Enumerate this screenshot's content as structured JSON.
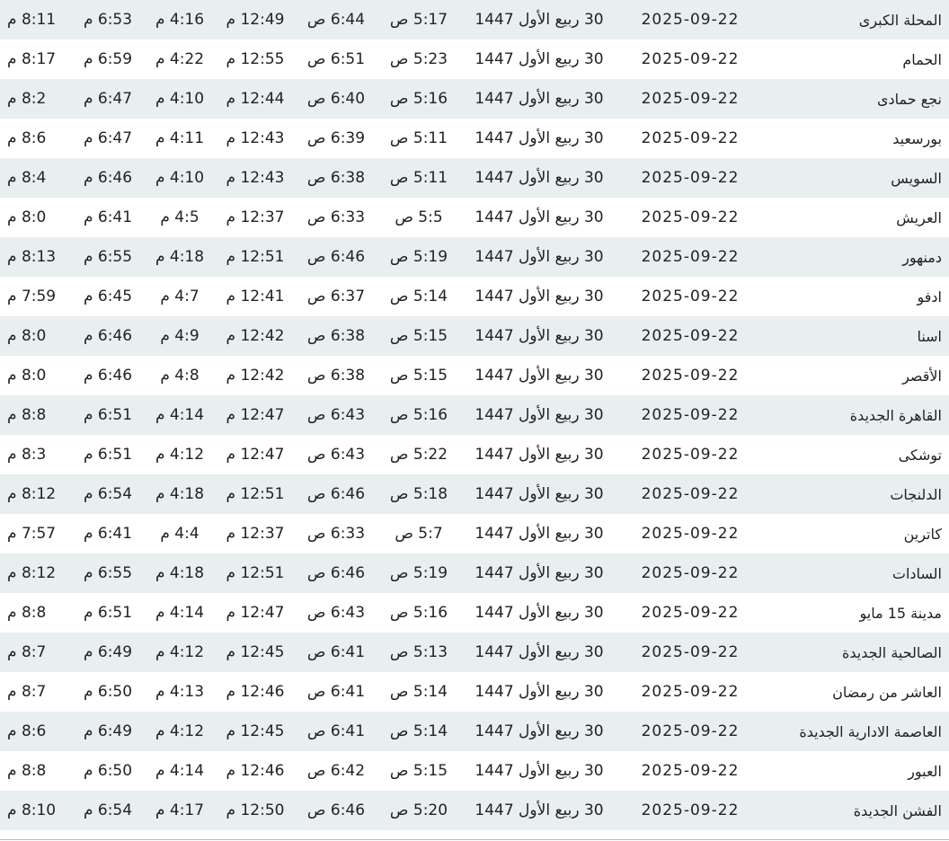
{
  "table": {
    "rows": [
      {
        "city": "المحلة الكبرى",
        "date": "2025-09-22",
        "hijri": "30 ربيع الأول 1447",
        "fajr": "5:17 ص",
        "sunrise": "6:44 ص",
        "dhuhr": "12:49 م",
        "asr": "4:16 م",
        "maghrib": "6:53 م",
        "isha": "8:11 م"
      },
      {
        "city": "الحمام",
        "date": "2025-09-22",
        "hijri": "30 ربيع الأول 1447",
        "fajr": "5:23 ص",
        "sunrise": "6:51 ص",
        "dhuhr": "12:55 م",
        "asr": "4:22 م",
        "maghrib": "6:59 م",
        "isha": "8:17 م"
      },
      {
        "city": "نجع حمادى",
        "date": "2025-09-22",
        "hijri": "30 ربيع الأول 1447",
        "fajr": "5:16 ص",
        "sunrise": "6:40 ص",
        "dhuhr": "12:44 م",
        "asr": "4:10 م",
        "maghrib": "6:47 م",
        "isha": "8:2 م"
      },
      {
        "city": "بورسعيد",
        "date": "2025-09-22",
        "hijri": "30 ربيع الأول 1447",
        "fajr": "5:11 ص",
        "sunrise": "6:39 ص",
        "dhuhr": "12:43 م",
        "asr": "4:11 م",
        "maghrib": "6:47 م",
        "isha": "8:6 م"
      },
      {
        "city": "السويس",
        "date": "2025-09-22",
        "hijri": "30 ربيع الأول 1447",
        "fajr": "5:11 ص",
        "sunrise": "6:38 ص",
        "dhuhr": "12:43 م",
        "asr": "4:10 م",
        "maghrib": "6:46 م",
        "isha": "8:4 م"
      },
      {
        "city": "العريش",
        "date": "2025-09-22",
        "hijri": "30 ربيع الأول 1447",
        "fajr": "5:5 ص",
        "sunrise": "6:33 ص",
        "dhuhr": "12:37 م",
        "asr": "4:5 م",
        "maghrib": "6:41 م",
        "isha": "8:0 م"
      },
      {
        "city": "دمنهور",
        "date": "2025-09-22",
        "hijri": "30 ربيع الأول 1447",
        "fajr": "5:19 ص",
        "sunrise": "6:46 ص",
        "dhuhr": "12:51 م",
        "asr": "4:18 م",
        "maghrib": "6:55 م",
        "isha": "8:13 م"
      },
      {
        "city": "ادفو",
        "date": "2025-09-22",
        "hijri": "30 ربيع الأول 1447",
        "fajr": "5:14 ص",
        "sunrise": "6:37 ص",
        "dhuhr": "12:41 م",
        "asr": "4:7 م",
        "maghrib": "6:45 م",
        "isha": "7:59 م"
      },
      {
        "city": "اسنا",
        "date": "2025-09-22",
        "hijri": "30 ربيع الأول 1447",
        "fajr": "5:15 ص",
        "sunrise": "6:38 ص",
        "dhuhr": "12:42 م",
        "asr": "4:9 م",
        "maghrib": "6:46 م",
        "isha": "8:0 م"
      },
      {
        "city": "الأقصر",
        "date": "2025-09-22",
        "hijri": "30 ربيع الأول 1447",
        "fajr": "5:15 ص",
        "sunrise": "6:38 ص",
        "dhuhr": "12:42 م",
        "asr": "4:8 م",
        "maghrib": "6:46 م",
        "isha": "8:0 م"
      },
      {
        "city": "القاهرة الجديدة",
        "date": "2025-09-22",
        "hijri": "30 ربيع الأول 1447",
        "fajr": "5:16 ص",
        "sunrise": "6:43 ص",
        "dhuhr": "12:47 م",
        "asr": "4:14 م",
        "maghrib": "6:51 م",
        "isha": "8:8 م"
      },
      {
        "city": "توشكى",
        "date": "2025-09-22",
        "hijri": "30 ربيع الأول 1447",
        "fajr": "5:22 ص",
        "sunrise": "6:43 ص",
        "dhuhr": "12:47 م",
        "asr": "4:12 م",
        "maghrib": "6:51 م",
        "isha": "8:3 م"
      },
      {
        "city": "الدلنجات",
        "date": "2025-09-22",
        "hijri": "30 ربيع الأول 1447",
        "fajr": "5:18 ص",
        "sunrise": "6:46 ص",
        "dhuhr": "12:51 م",
        "asr": "4:18 م",
        "maghrib": "6:54 م",
        "isha": "8:12 م"
      },
      {
        "city": "كاترين",
        "date": "2025-09-22",
        "hijri": "30 ربيع الأول 1447",
        "fajr": "5:7 ص",
        "sunrise": "6:33 ص",
        "dhuhr": "12:37 م",
        "asr": "4:4 م",
        "maghrib": "6:41 م",
        "isha": "7:57 م"
      },
      {
        "city": "السادات",
        "date": "2025-09-22",
        "hijri": "30 ربيع الأول 1447",
        "fajr": "5:19 ص",
        "sunrise": "6:46 ص",
        "dhuhr": "12:51 م",
        "asr": "4:18 م",
        "maghrib": "6:55 م",
        "isha": "8:12 م"
      },
      {
        "city": "مدينة 15 مايو",
        "date": "2025-09-22",
        "hijri": "30 ربيع الأول 1447",
        "fajr": "5:16 ص",
        "sunrise": "6:43 ص",
        "dhuhr": "12:47 م",
        "asr": "4:14 م",
        "maghrib": "6:51 م",
        "isha": "8:8 م"
      },
      {
        "city": "الصالحية الجديدة",
        "date": "2025-09-22",
        "hijri": "30 ربيع الأول 1447",
        "fajr": "5:13 ص",
        "sunrise": "6:41 ص",
        "dhuhr": "12:45 م",
        "asr": "4:12 م",
        "maghrib": "6:49 م",
        "isha": "8:7 م"
      },
      {
        "city": "العاشر من رمضان",
        "date": "2025-09-22",
        "hijri": "30 ربيع الأول 1447",
        "fajr": "5:14 ص",
        "sunrise": "6:41 ص",
        "dhuhr": "12:46 م",
        "asr": "4:13 م",
        "maghrib": "6:50 م",
        "isha": "8:7 م"
      },
      {
        "city": "العاصمة الادارية الجديدة",
        "date": "2025-09-22",
        "hijri": "30 ربيع الأول 1447",
        "fajr": "5:14 ص",
        "sunrise": "6:41 ص",
        "dhuhr": "12:45 م",
        "asr": "4:12 م",
        "maghrib": "6:49 م",
        "isha": "8:6 م"
      },
      {
        "city": "العبور",
        "date": "2025-09-22",
        "hijri": "30 ربيع الأول 1447",
        "fajr": "5:15 ص",
        "sunrise": "6:42 ص",
        "dhuhr": "12:46 م",
        "asr": "4:14 م",
        "maghrib": "6:50 م",
        "isha": "8:8 م"
      },
      {
        "city": "الفشن الجديدة",
        "date": "2025-09-22",
        "hijri": "30 ربيع الأول 1447",
        "fajr": "5:20 ص",
        "sunrise": "6:46 ص",
        "dhuhr": "12:50 م",
        "asr": "4:17 م",
        "maghrib": "6:54 م",
        "isha": "8:10 م"
      }
    ]
  }
}
